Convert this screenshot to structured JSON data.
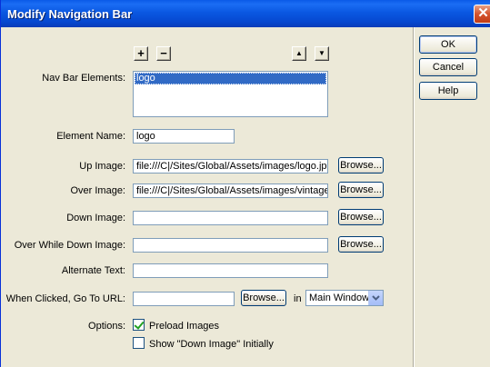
{
  "window": {
    "title": "Modify Navigation Bar",
    "close_glyph": "✕"
  },
  "nav_bar": {
    "label": "Nav Bar Elements:",
    "add_glyph": "+",
    "remove_glyph": "−",
    "up_glyph": "▲",
    "down_glyph": "▼",
    "items": [
      "logo"
    ]
  },
  "element_name": {
    "label": "Element Name:",
    "value": "logo"
  },
  "up_image": {
    "label": "Up Image:",
    "value": "file:///C|/Sites/Global/Assets/images/logo.jpg",
    "browse": "Browse..."
  },
  "over_image": {
    "label": "Over Image:",
    "value": "file:///C|/Sites/Global/Assets/images/vintage.jpg",
    "browse": "Browse..."
  },
  "down_image": {
    "label": "Down Image:",
    "value": "",
    "browse": "Browse..."
  },
  "over_while_down": {
    "label": "Over While Down Image:",
    "value": "",
    "browse": "Browse..."
  },
  "alternate_text": {
    "label": "Alternate Text:",
    "value": ""
  },
  "when_clicked": {
    "label": "When Clicked, Go To URL:",
    "value": "",
    "browse": "Browse...",
    "in_label": "in",
    "target": "Main Window"
  },
  "options": {
    "label": "Options:",
    "preload": {
      "label": "Preload Images",
      "checked": true
    },
    "show_down": {
      "label": "Show \"Down Image\" Initially",
      "checked": false
    }
  },
  "buttons": {
    "ok": "OK",
    "cancel": "Cancel",
    "help": "Help"
  }
}
